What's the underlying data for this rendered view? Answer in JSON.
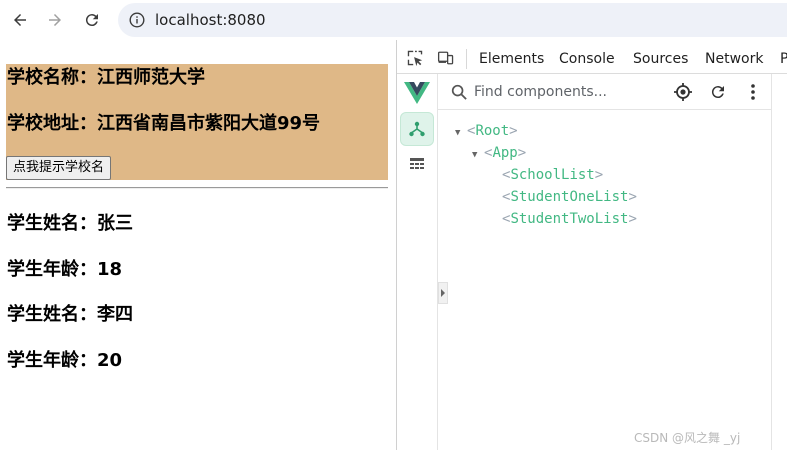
{
  "browser": {
    "url": "localhost:8080",
    "icons": {
      "back": "arrow-left-icon",
      "forward": "arrow-right-icon",
      "reload": "reload-icon",
      "site_info": "info-icon"
    }
  },
  "page": {
    "school": {
      "name_line": "学校名称：江西师范大学",
      "address_line": "学校地址：江西省南昌市紫阳大道99号",
      "button_label": "点我提示学校名",
      "background": "#dfb887"
    },
    "students": [
      {
        "name_line": "学生姓名：张三",
        "age_line": "学生年龄：18"
      },
      {
        "name_line": "学生姓名：李四",
        "age_line": "学生年龄：20"
      }
    ]
  },
  "devtools": {
    "tabs": [
      "Elements",
      "Console",
      "Sources",
      "Network",
      "P"
    ],
    "vue": {
      "search_placeholder": "Find components...",
      "tree": [
        {
          "label": "Root",
          "expanded": true
        },
        {
          "label": "App",
          "expanded": true
        },
        {
          "label": "SchoolList"
        },
        {
          "label": "StudentOneList"
        },
        {
          "label": "StudentTwoList"
        }
      ],
      "accent": "#42b883"
    }
  },
  "watermark": "CSDN @风之舞 _yj"
}
